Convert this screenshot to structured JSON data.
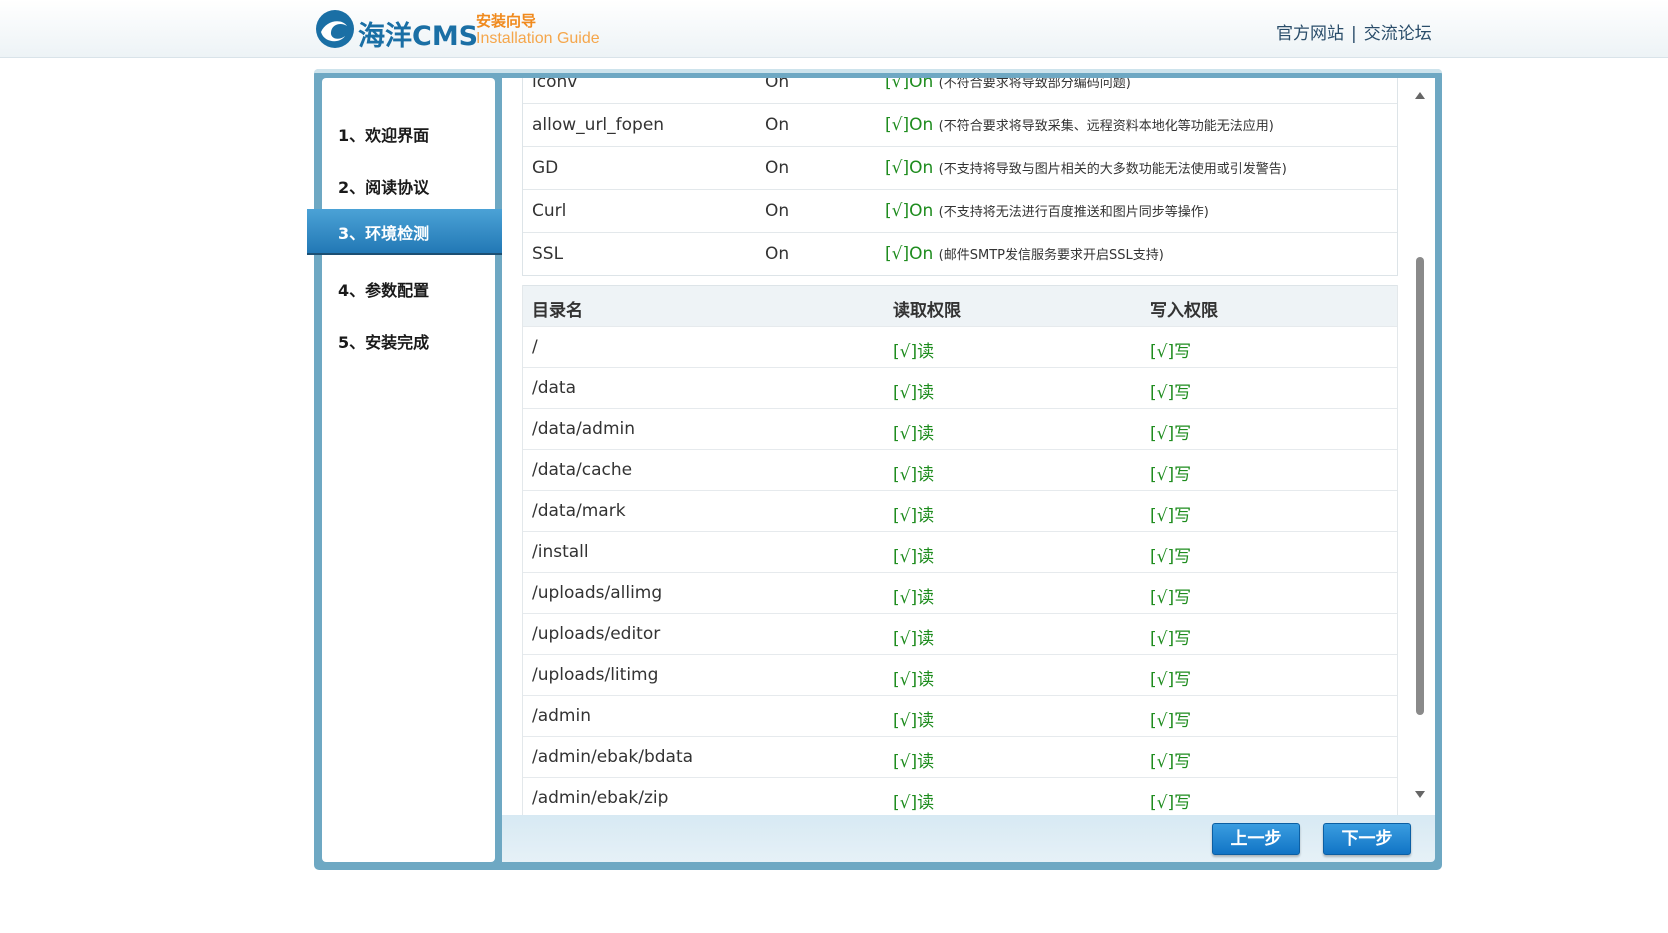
{
  "header": {
    "brand": "海洋CMS",
    "guide_cn": "安装向导",
    "guide_en": "Installation Guide",
    "links": [
      "官方网站",
      "交流论坛"
    ],
    "separator": "|"
  },
  "steps": [
    {
      "label": "1、欢迎界面"
    },
    {
      "label": "2、阅读协议"
    },
    {
      "label": "3、环境检测",
      "active": true
    },
    {
      "label": "4、参数配置"
    },
    {
      "label": "5、安装完成"
    }
  ],
  "env_table": {
    "rows": [
      {
        "name": "iconv",
        "value": "On",
        "status": "[√]On",
        "note": "(不符合要求将导致部分编码问题)"
      },
      {
        "name": "allow_url_fopen",
        "value": "On",
        "status": "[√]On",
        "note": "(不符合要求将导致采集、远程资料本地化等功能无法应用)"
      },
      {
        "name": "GD",
        "value": "On",
        "status": "[√]On",
        "note": "(不支持将导致与图片相关的大多数功能无法使用或引发警告)"
      },
      {
        "name": "Curl",
        "value": "On",
        "status": "[√]On",
        "note": "(不支持将无法进行百度推送和图片同步等操作)"
      },
      {
        "name": "SSL",
        "value": "On",
        "status": "[√]On",
        "note": "(邮件SMTP发信服务要求开启SSL支持)"
      }
    ]
  },
  "dir_table": {
    "headers": [
      "目录名",
      "读取权限",
      "写入权限"
    ],
    "rows": [
      {
        "dir": "/",
        "read": "[√]读",
        "write": "[√]写"
      },
      {
        "dir": "/data",
        "read": "[√]读",
        "write": "[√]写"
      },
      {
        "dir": "/data/admin",
        "read": "[√]读",
        "write": "[√]写"
      },
      {
        "dir": "/data/cache",
        "read": "[√]读",
        "write": "[√]写"
      },
      {
        "dir": "/data/mark",
        "read": "[√]读",
        "write": "[√]写"
      },
      {
        "dir": "/install",
        "read": "[√]读",
        "write": "[√]写"
      },
      {
        "dir": "/uploads/allimg",
        "read": "[√]读",
        "write": "[√]写"
      },
      {
        "dir": "/uploads/editor",
        "read": "[√]读",
        "write": "[√]写"
      },
      {
        "dir": "/uploads/litimg",
        "read": "[√]读",
        "write": "[√]写"
      },
      {
        "dir": "/admin",
        "read": "[√]读",
        "write": "[√]写"
      },
      {
        "dir": "/admin/ebak/bdata",
        "read": "[√]读",
        "write": "[√]写"
      },
      {
        "dir": "/admin/ebak/zip",
        "read": "[√]读",
        "write": "[√]写"
      }
    ]
  },
  "buttons": {
    "prev": "上一步",
    "next": "下一步"
  },
  "colors": {
    "frame": "#6ea8c3",
    "accent": "#1a6fa5",
    "ok": "#1e8c1e",
    "orange": "#f08a1d"
  }
}
